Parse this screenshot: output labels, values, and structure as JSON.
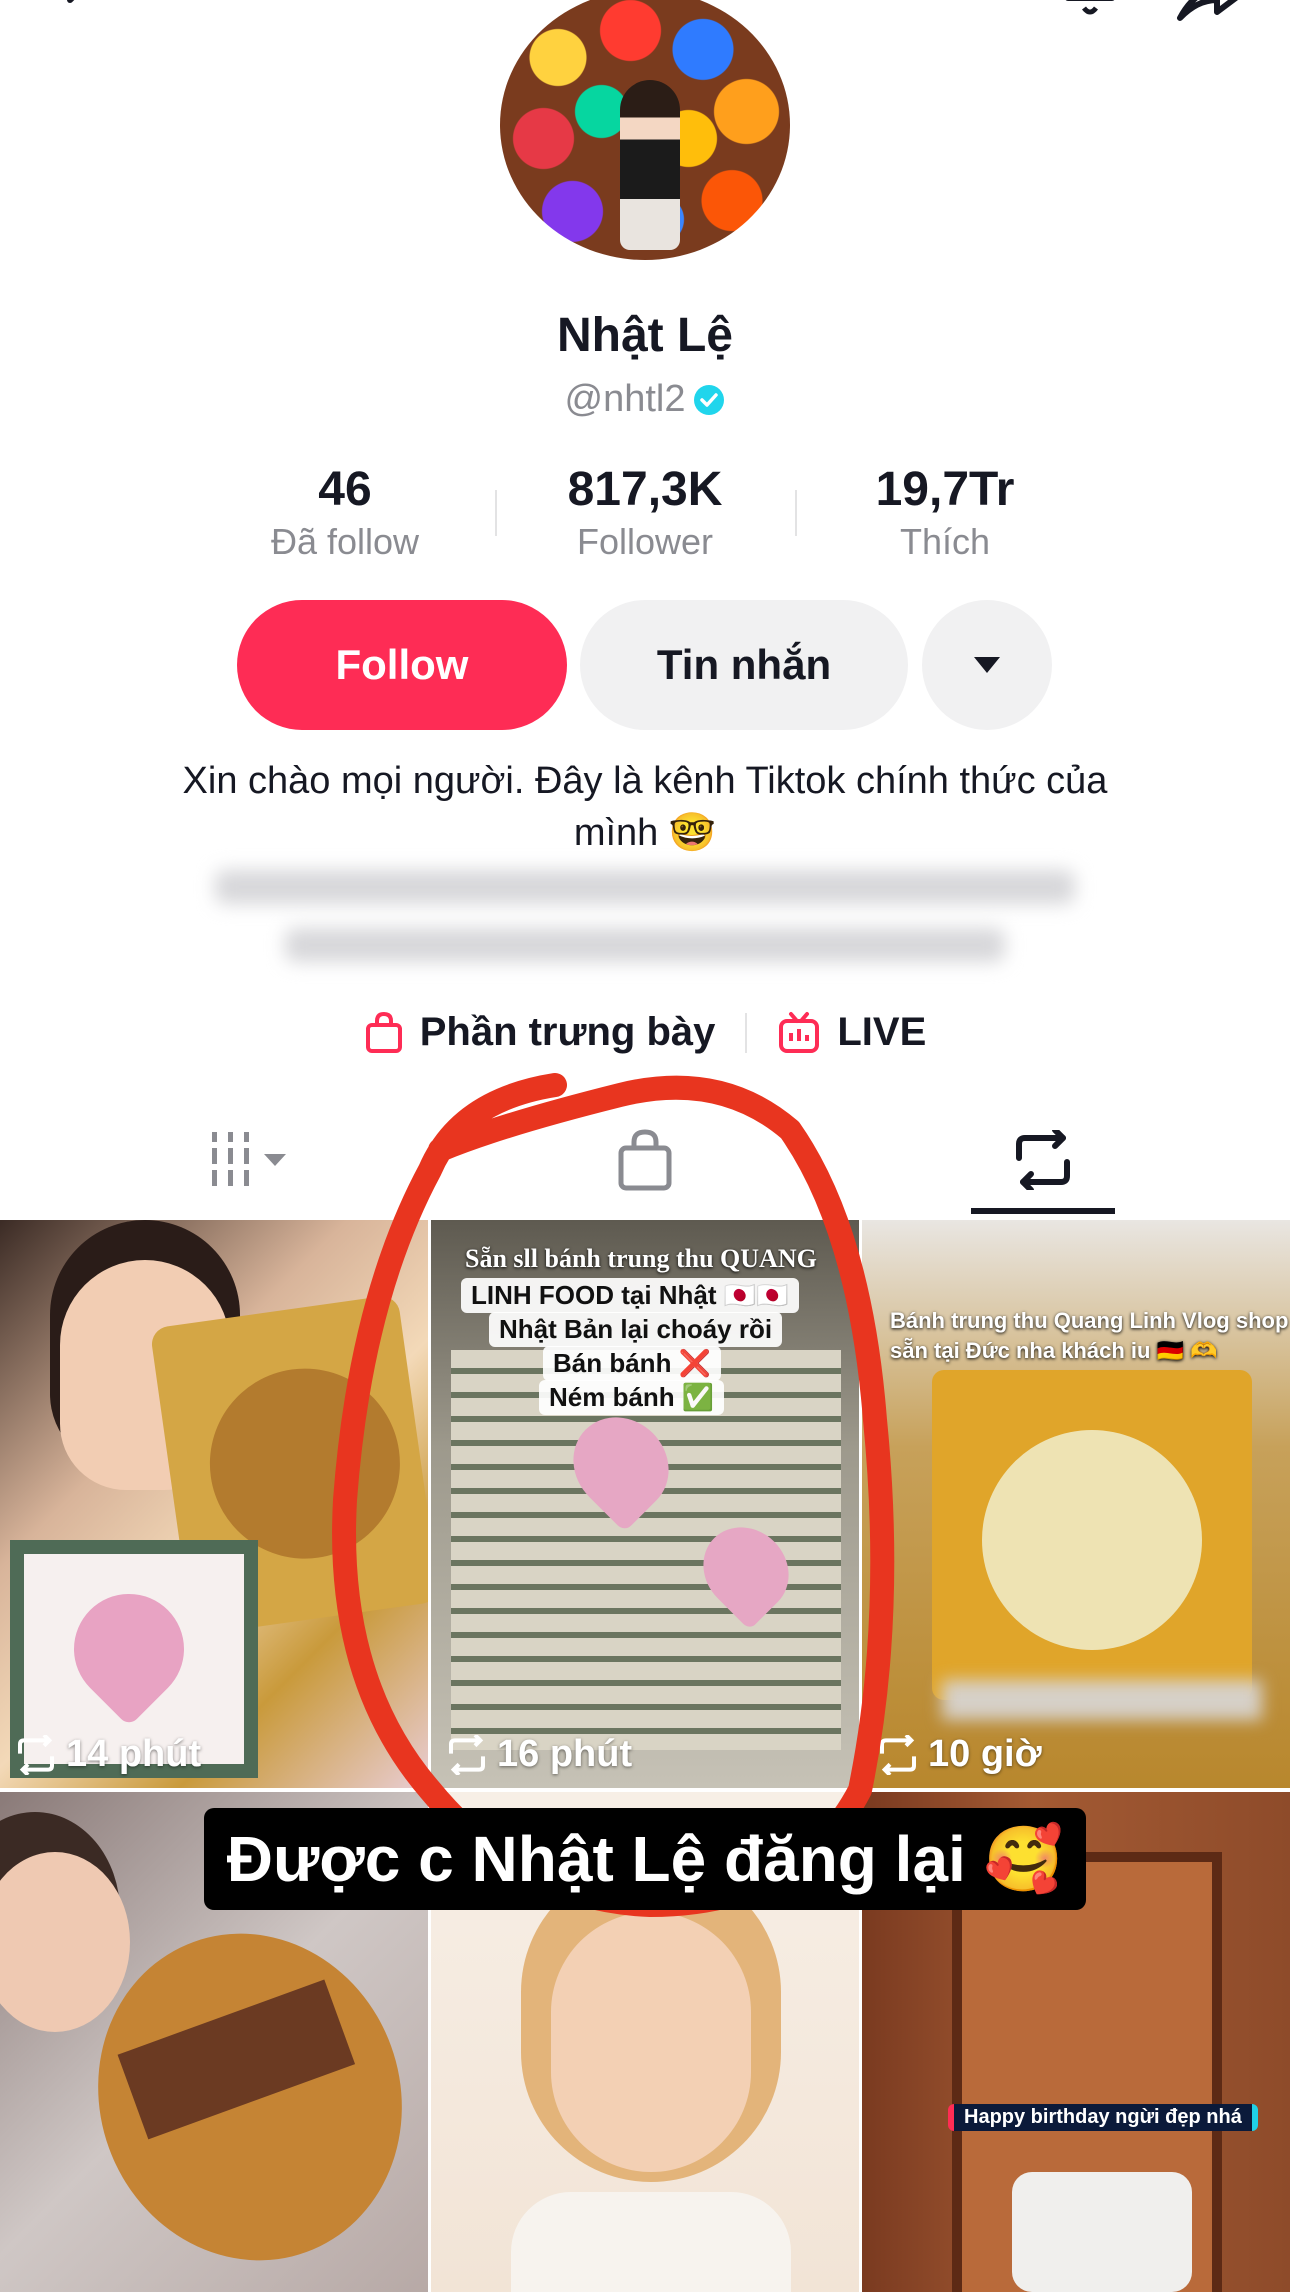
{
  "profile": {
    "display_name": "Nhật Lệ",
    "username": "@nhtl2",
    "verified": true
  },
  "stats": [
    {
      "value": "46",
      "label": "Đã follow"
    },
    {
      "value": "817,3K",
      "label": "Follower"
    },
    {
      "value": "19,7Tr",
      "label": "Thích"
    }
  ],
  "actions": {
    "follow_label": "Follow",
    "message_label": "Tin nhắn"
  },
  "bio": {
    "line1": "Xin chào mọi người. Đây là kênh Tiktok chính thức của",
    "line2": "mình 🤓"
  },
  "links": {
    "showcase_label": "Phần trưng bày",
    "live_label": "LIVE"
  },
  "tabs": [
    {
      "icon": "grid-icon",
      "active": false
    },
    {
      "icon": "shopping-bag-icon",
      "active": false
    },
    {
      "icon": "repost-icon",
      "active": true
    }
  ],
  "videos": [
    {
      "time": "14 phút",
      "overlay": []
    },
    {
      "time": "16 phút",
      "overlay": [
        "Sẵn sll bánh trung thu QUANG",
        "LINH FOOD tại Nhật 🇯🇵🇯🇵",
        "Nhật Bản lại choáy rồi",
        "Bán bánh ❌",
        "Ném bánh ✅"
      ]
    },
    {
      "time": "10 giờ",
      "overlay": [
        "Bánh trung thu Quang Linh Vlog shop",
        "sẵn tại Đức nha khách iu 🇩🇪 🫶"
      ]
    },
    {
      "time": "",
      "overlay": []
    },
    {
      "time": "",
      "overlay": []
    },
    {
      "time": "",
      "overlay": [
        "Happy birthday ngừi đẹp nhá"
      ]
    }
  ],
  "caption": "Được c Nhật Lệ đăng lại 🥰",
  "colors": {
    "accent": "#fe2c55",
    "annotation": "#e8351f",
    "verified": "#20d5ec"
  }
}
